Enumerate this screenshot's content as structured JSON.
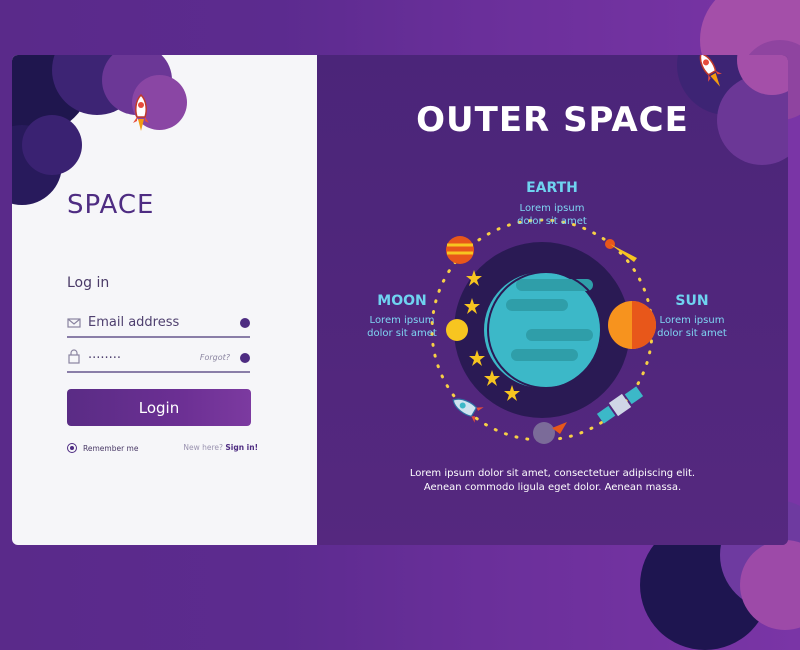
{
  "login": {
    "app_title": "SPACE",
    "heading": "Log in",
    "email_label": "Email address",
    "password_value": "........",
    "forgot_label": "Forgot?",
    "login_button": "Login",
    "remember_label": "Remember me",
    "new_here_label": "New here?",
    "sign_in_label": "Sign in!"
  },
  "space": {
    "title": "OUTER SPACE",
    "earth": {
      "label": "EARTH",
      "desc_line1": "Lorem ipsum",
      "desc_line2": "dolor sit amet"
    },
    "moon": {
      "label": "MOON",
      "desc_line1": "Lorem ipsum",
      "desc_line2": "dolor sit amet"
    },
    "sun": {
      "label": "SUN",
      "desc_line1": "Lorem ipsum",
      "desc_line2": "dolor sit amet"
    },
    "footer_line1": "Lorem ipsum dolor sit amet, consectetuer adipiscing elit.",
    "footer_line2": "Aenean commodo ligula eget dolor. Aenean massa."
  },
  "colors": {
    "accent": "#4e2c82",
    "background": "#5c2b8f",
    "label": "#6fd3f0",
    "sun": "#f7931e",
    "moon": "#f7c520"
  }
}
